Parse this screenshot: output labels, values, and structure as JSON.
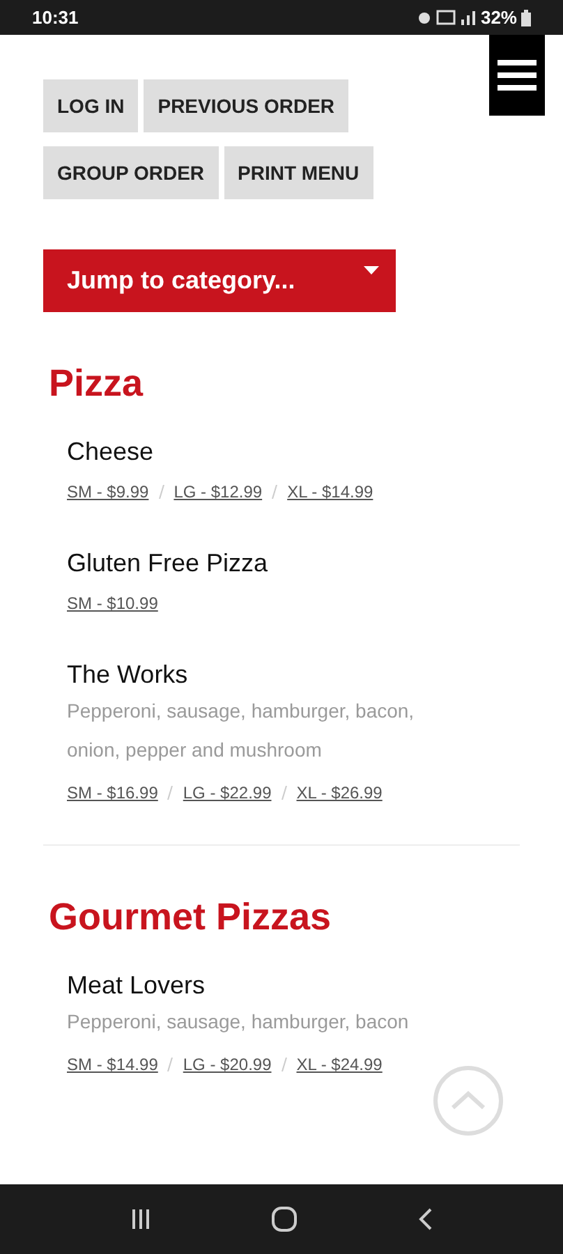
{
  "status_bar": {
    "time": "10:31",
    "battery": "32%"
  },
  "buttons": [
    {
      "label": "LOG IN"
    },
    {
      "label": "PREVIOUS ORDER"
    },
    {
      "label": "GROUP ORDER"
    },
    {
      "label": "PRINT MENU"
    }
  ],
  "category_select": {
    "label": "Jump to category..."
  },
  "sections": [
    {
      "title": "Pizza",
      "items": [
        {
          "name": "Cheese",
          "prices": [
            "SM - $9.99",
            "LG - $12.99",
            "XL - $14.99"
          ]
        },
        {
          "name": "Gluten Free Pizza",
          "prices": [
            "SM - $10.99"
          ]
        },
        {
          "name": "The Works",
          "description": "Pepperoni, sausage, hamburger, bacon, onion, pepper and mushroom",
          "prices": [
            "SM - $16.99",
            "LG - $22.99",
            "XL - $26.99"
          ]
        }
      ]
    },
    {
      "title": "Gourmet Pizzas",
      "items": [
        {
          "name": "Meat Lovers",
          "description": "Pepperoni, sausage, hamburger, bacon",
          "prices": [
            "SM - $14.99",
            "LG - $20.99",
            "XL - $24.99"
          ]
        }
      ]
    }
  ]
}
